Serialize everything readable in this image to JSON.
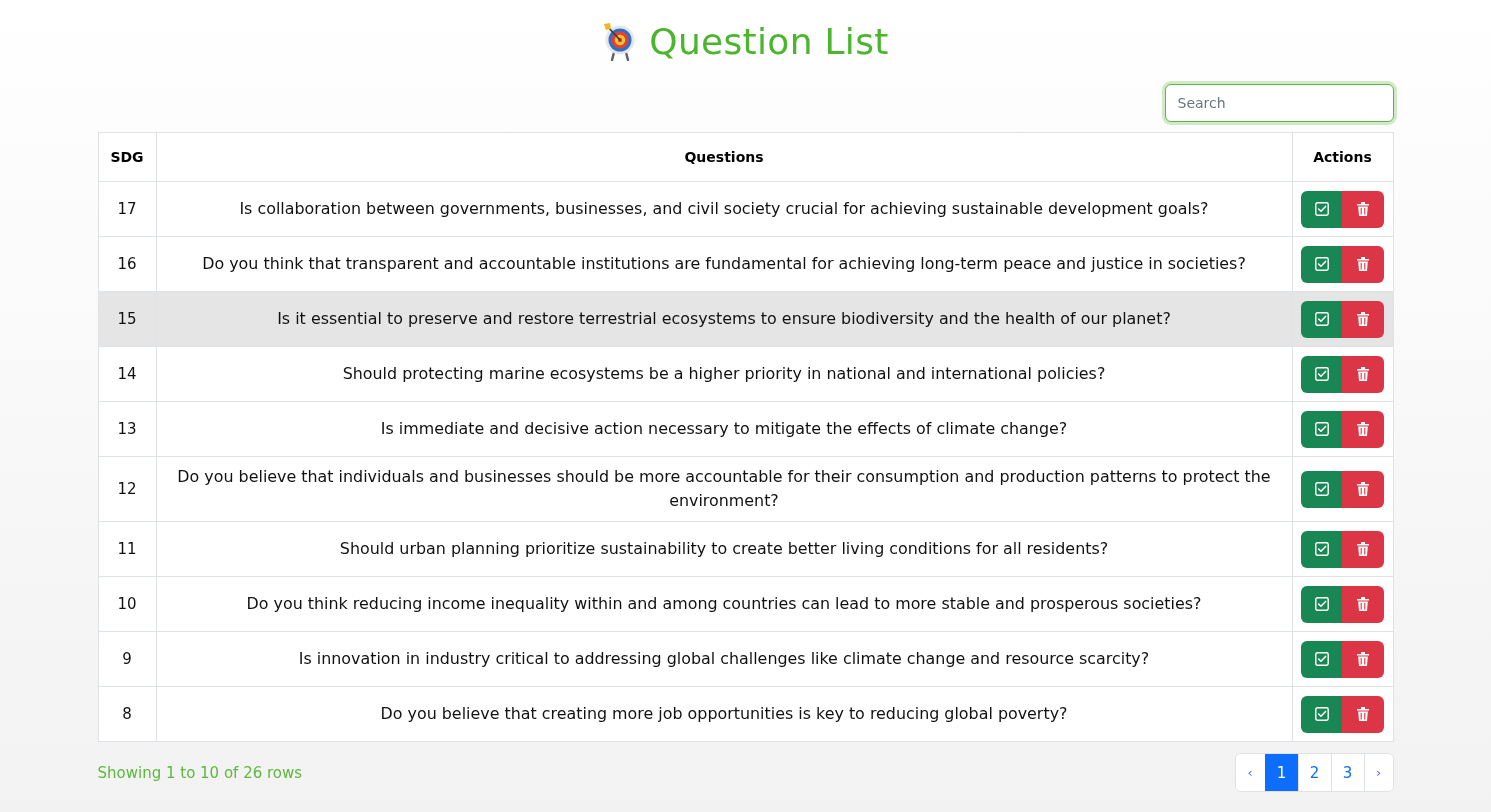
{
  "page": {
    "title": "Question List"
  },
  "search": {
    "placeholder": "Search",
    "focused": true
  },
  "table": {
    "columns": [
      "SDG",
      "Questions",
      "Actions"
    ],
    "rows": [
      {
        "sdg": "17",
        "question": "Is collaboration between governments, businesses, and civil society crucial for achieving sustainable development goals?",
        "highlighted": false
      },
      {
        "sdg": "16",
        "question": "Do you think that transparent and accountable institutions are fundamental for achieving long-term peace and justice in societies?",
        "highlighted": false
      },
      {
        "sdg": "15",
        "question": "Is it essential to preserve and restore terrestrial ecosystems to ensure biodiversity and the health of our planet?",
        "highlighted": true
      },
      {
        "sdg": "14",
        "question": "Should protecting marine ecosystems be a higher priority in national and international policies?",
        "highlighted": false
      },
      {
        "sdg": "13",
        "question": "Is immediate and decisive action necessary to mitigate the effects of climate change?",
        "highlighted": false
      },
      {
        "sdg": "12",
        "question": "Do you believe that individuals and businesses should be more accountable for their consumption and production patterns to protect the environment?",
        "highlighted": false
      },
      {
        "sdg": "11",
        "question": "Should urban planning prioritize sustainability to create better living conditions for all residents?",
        "highlighted": false
      },
      {
        "sdg": "10",
        "question": "Do you think reducing income inequality within and among countries can lead to more stable and prosperous societies?",
        "highlighted": false
      },
      {
        "sdg": "9",
        "question": "Is innovation in industry critical to addressing global challenges like climate change and resource scarcity?",
        "highlighted": false
      },
      {
        "sdg": "8",
        "question": "Do you believe that creating more job opportunities is key to reducing global poverty?",
        "highlighted": false
      }
    ]
  },
  "footer": {
    "summary": "Showing 1 to 10 of 26 rows"
  },
  "pagination": {
    "items": [
      {
        "label": "‹",
        "kind": "arrow",
        "selected": false
      },
      {
        "label": "1",
        "kind": "page",
        "selected": true
      },
      {
        "label": "2",
        "kind": "page",
        "selected": false
      },
      {
        "label": "3",
        "kind": "page",
        "selected": false
      },
      {
        "label": "›",
        "kind": "arrow",
        "selected": false
      }
    ]
  }
}
